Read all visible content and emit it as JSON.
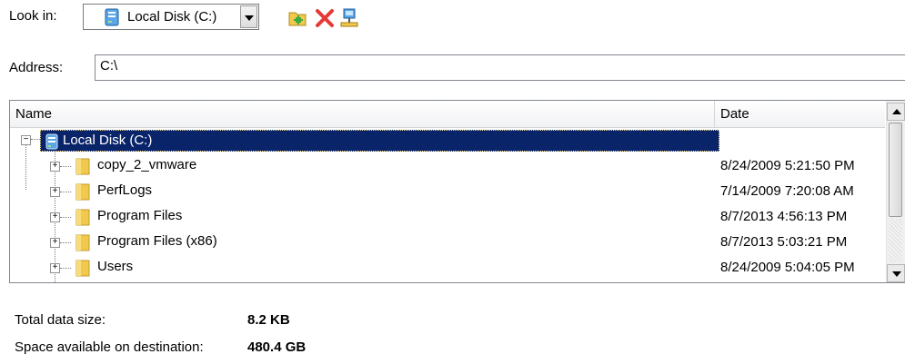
{
  "look_in": {
    "label": "Look in:",
    "selected": "Local Disk (C:)",
    "icon": "hard-drive-icon"
  },
  "toolbar": {
    "new_folder_icon": "new-folder-icon",
    "delete_icon": "delete-icon",
    "network_icon": "network-drive-icon"
  },
  "address": {
    "label": "Address:",
    "value": "C:\\"
  },
  "table": {
    "columns": [
      "Name",
      "Date"
    ],
    "root": {
      "name": "Local Disk (C:)",
      "date": ""
    },
    "rows": [
      {
        "name": "copy_2_vmware",
        "date": "8/24/2009 5:21:50 PM"
      },
      {
        "name": "PerfLogs",
        "date": "7/14/2009 7:20:08 AM"
      },
      {
        "name": "Program Files",
        "date": "8/7/2013 4:56:13 PM"
      },
      {
        "name": "Program Files (x86)",
        "date": "8/7/2013 5:03:21 PM"
      },
      {
        "name": "Users",
        "date": "8/24/2009 5:04:05 PM"
      }
    ]
  },
  "stats": {
    "total_label": "Total data size:",
    "total_value": "8.2 KB",
    "space_label": "Space available on destination:",
    "space_value": "480.4 GB"
  },
  "colors": {
    "selection": "#0a246a",
    "folder": "#f2c94c",
    "delete": "#e53935"
  }
}
